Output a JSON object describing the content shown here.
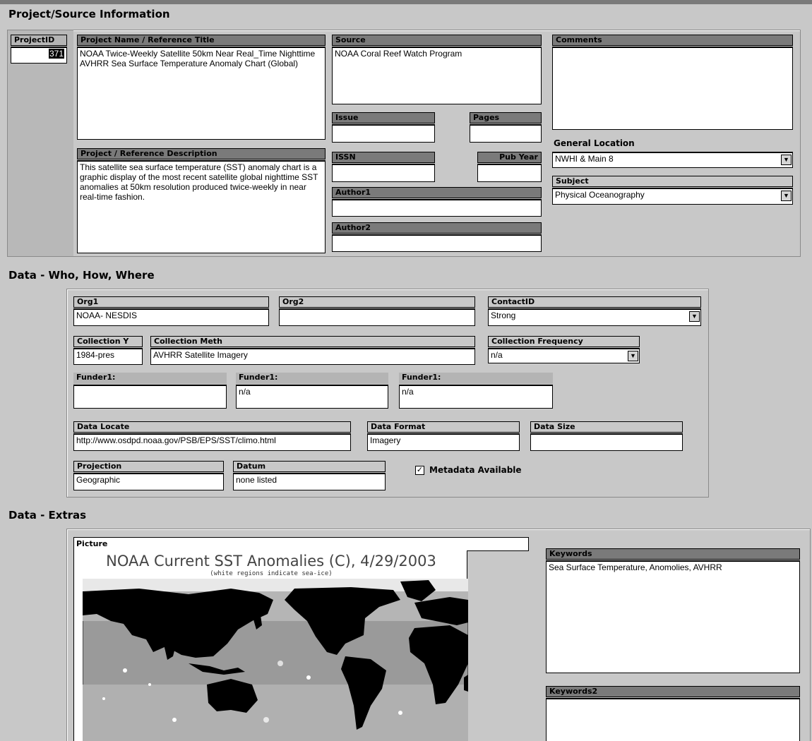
{
  "sections": {
    "project": "Project/Source Information",
    "who": "Data - Who, How, Where",
    "extras": "Data - Extras"
  },
  "project": {
    "project_id_label": "ProjectID",
    "project_id": "371",
    "name_label": "Project Name / Reference Title",
    "name": "NOAA Twice-Weekly Satellite 50km Near Real_Time Nighttime AVHRR Sea Surface Temperature Anomaly Chart (Global)",
    "description_label": "Project / Reference Description",
    "description": "This satellite sea surface temperature (SST) anomaly chart is a graphic display of the most recent satellite global nighttime SST anomalies at 50km resolution produced twice-weekly in near real-time fashion.",
    "source_label": "Source",
    "source": "NOAA Coral Reef Watch Program",
    "issue_label": "Issue",
    "issue": "",
    "pages_label": "Pages",
    "pages": "",
    "issn_label": "ISSN",
    "issn": "",
    "pub_year_label": "Pub Year",
    "pub_year": "",
    "author1_label": "Author1",
    "author1": "",
    "author2_label": "Author2",
    "author2": "",
    "comments_label": "Comments",
    "comments": "",
    "general_location_label": "General Location",
    "general_location": "NWHI & Main 8",
    "subject_label": "Subject",
    "subject": "Physical Oceanography"
  },
  "who": {
    "org1_label": "Org1",
    "org1": "NOAA- NESDIS",
    "org2_label": "Org2",
    "org2": "",
    "contact_label": "ContactID",
    "contact": "Strong",
    "collection_year_label": "Collection Y",
    "collection_year": "1984-pres",
    "collection_method_label": "Collection Meth",
    "collection_method": "AVHRR Satellite Imagery",
    "collection_frequency_label": "Collection Frequency",
    "collection_frequency": "n/a",
    "funder1_label": "Funder1:",
    "funder1": "",
    "funder2_label": "Funder1:",
    "funder2": "n/a",
    "funder3_label": "Funder1:",
    "funder3": "n/a",
    "data_locate_label": "Data Locate",
    "data_locate": "http://www.osdpd.noaa.gov/PSB/EPS/SST/climo.html",
    "data_format_label": "Data Format",
    "data_format": "Imagery",
    "data_size_label": "Data Size",
    "data_size": "",
    "projection_label": "Projection",
    "projection": "Geographic",
    "datum_label": "Datum",
    "datum": "none listed",
    "metadata_label": "Metadata Available",
    "metadata_checked": true
  },
  "extras": {
    "picture_label": "Picture",
    "picture_title": "NOAA Current SST Anomalies (C), 4/29/2003",
    "picture_subtitle": "(white regions indicate sea-ice)",
    "keywords_label": "Keywords",
    "keywords": "Sea Surface Temperature, Anomolies, AVHRR",
    "keywords2_label": "Keywords2",
    "keywords2": ""
  },
  "icons": {
    "dropdown": "chevron-down-icon",
    "checkbox": "checkmark-icon"
  }
}
